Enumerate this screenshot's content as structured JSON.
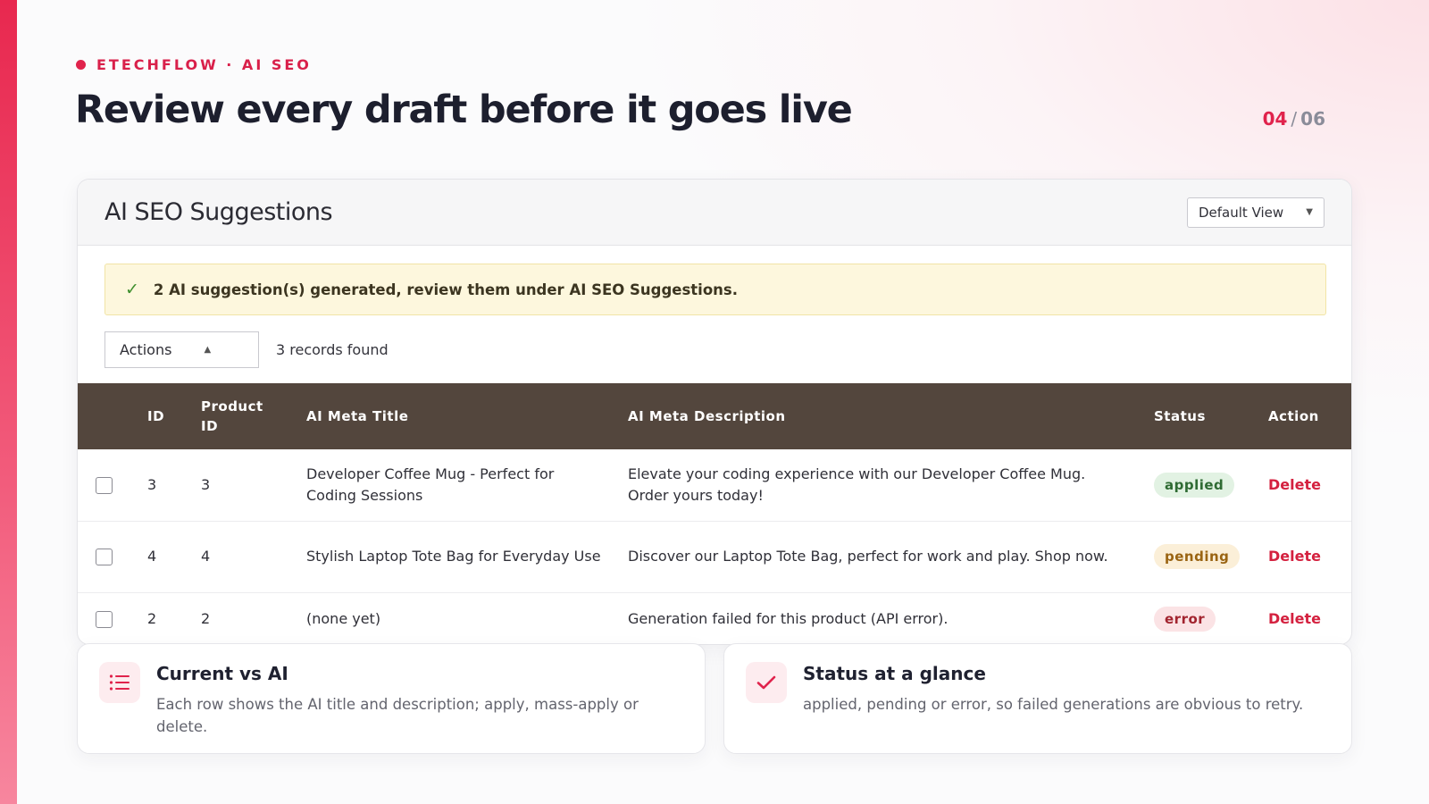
{
  "slide": {
    "eyebrow": "ETECHFLOW · AI SEO",
    "title": "Review every draft before it goes live",
    "page_current": "04",
    "page_separator": "/",
    "page_total": "06"
  },
  "panel": {
    "title": "AI SEO Suggestions",
    "view_select": "Default View",
    "notice": "2 AI suggestion(s) generated, review them under AI SEO Suggestions.",
    "actions_label": "Actions",
    "records_found": "3 records found"
  },
  "table": {
    "headers": {
      "id": "ID",
      "product_id_line1": "Product",
      "product_id_line2": "ID",
      "meta_title": "AI Meta Title",
      "meta_description": "AI Meta Description",
      "status": "Status",
      "action": "Action"
    },
    "rows": [
      {
        "id": "3",
        "product_id": "3",
        "meta_title": "Developer Coffee Mug - Perfect for Coding Sessions",
        "meta_description": "Elevate your coding experience with our Developer Coffee Mug. Order yours today!",
        "status": "applied",
        "action": "Delete"
      },
      {
        "id": "4",
        "product_id": "4",
        "meta_title": "Stylish Laptop Tote Bag for Everyday Use",
        "meta_description": "Discover our Laptop Tote Bag, perfect for work and play. Shop now.",
        "status": "pending",
        "action": "Delete"
      },
      {
        "id": "2",
        "product_id": "2",
        "meta_title": "(none yet)",
        "meta_description": "Generation failed for this product (API error).",
        "status": "error",
        "action": "Delete"
      }
    ]
  },
  "cards": {
    "left": {
      "icon": "list-icon",
      "title": "Current vs AI",
      "text": "Each row shows the AI title and description; apply, mass-apply or delete."
    },
    "right": {
      "icon": "check-icon",
      "title": "Status at a glance",
      "text": "applied, pending or error, so failed generations are obvious to retry."
    }
  },
  "colors": {
    "accent": "#e0234c",
    "table_header": "#53463d",
    "notice_bg": "#fdf7dd"
  }
}
